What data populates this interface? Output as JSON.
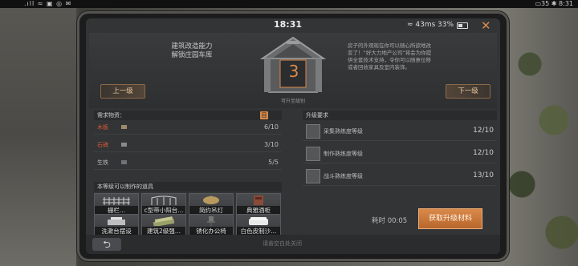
{
  "system_bar": {
    "left": ".ıll ≈ ▣ ◎ ✉",
    "right": "▭35 ✱ 8:31"
  },
  "status": {
    "time": "18:31",
    "network": "43ms",
    "battery": "33%"
  },
  "top": {
    "ability_line1": "建筑改造能力",
    "ability_line2": "解锁庄园车库",
    "level": "3",
    "level_label": "可升至级别",
    "prev_label": "上一级",
    "next_label": "下一级",
    "description": "房子的外观现在你可以随心所欲地改变了！“好大力地产公司”将会为你提供全套技术支持，令你可以随意位移或者回收家具及室内装饰。"
  },
  "materials": {
    "title": "需求物资：",
    "icon": "目",
    "items": [
      {
        "name": "木板",
        "count": "6/10",
        "color": "#d95a3a"
      },
      {
        "name": "石碑",
        "count": "3/10",
        "color": "#d95a3a"
      },
      {
        "name": "生铁",
        "count": "5/5",
        "color": "#bbbbbb"
      }
    ]
  },
  "tools": {
    "title": "本等级可以制作的道具",
    "items": [
      {
        "label": "栅栏..."
      },
      {
        "label": "c型带小阳台..."
      },
      {
        "label": "简约吊灯"
      },
      {
        "label": "典雅酒柜"
      },
      {
        "label": "洗漱台摆设"
      },
      {
        "label": "建筑2级强..."
      },
      {
        "label": "锈化办公椅"
      },
      {
        "label": "白色皮制沙..."
      }
    ]
  },
  "requirements": {
    "title": "升级要求",
    "items": [
      {
        "name": "采集熟练度等级",
        "value": "12/10"
      },
      {
        "name": "制作熟练度等级",
        "value": "12/10"
      },
      {
        "name": "战斗熟练度等级",
        "value": "13/10"
      }
    ]
  },
  "footer": {
    "time_label": "耗时 00:05",
    "get_button": "获取升级材料",
    "back_icon": "⮌",
    "hint": "请善空白处关闭"
  },
  "colors": {
    "accent": "#d98a4a",
    "insufficient": "#d95a3a"
  }
}
